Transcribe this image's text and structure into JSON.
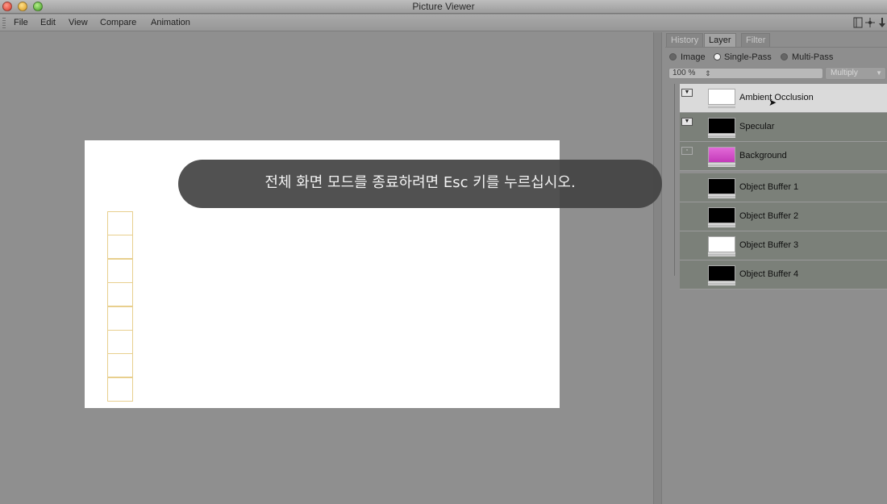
{
  "window": {
    "title": "Picture Viewer"
  },
  "menubar": {
    "items": [
      "File",
      "Edit",
      "View",
      "Compare",
      "Animation"
    ],
    "icons": [
      "panel-layout-icon",
      "move-icon",
      "pin-icon"
    ]
  },
  "canvas": {
    "background": "#ffffff",
    "cell_count": 8,
    "cell_border": "#e8cf8e"
  },
  "panel": {
    "tabs": [
      {
        "label": "History",
        "active": false
      },
      {
        "label": "Layer",
        "active": true
      },
      {
        "label": "Filter",
        "active": false
      }
    ],
    "modes": [
      {
        "label": "Image",
        "selected": false
      },
      {
        "label": "Single-Pass",
        "selected": true
      },
      {
        "label": "Multi-Pass",
        "selected": false
      }
    ],
    "opacity": "100 %",
    "blend_mode": "Multiply",
    "layers": [
      {
        "name": "Ambient Occlusion",
        "toggle": "visible",
        "thumb": "#ffffff",
        "active": true
      },
      {
        "name": "Specular",
        "toggle": "visible",
        "thumb": "#000000",
        "active": false
      },
      {
        "name": "Background",
        "toggle": "hollow",
        "thumb": "#d64ecb",
        "active": false
      },
      {
        "name": "Object Buffer 1",
        "toggle": "none",
        "thumb": "#000000",
        "active": false
      },
      {
        "name": "Object Buffer 2",
        "toggle": "none",
        "thumb": "#000000",
        "active": false
      },
      {
        "name": "Object Buffer 3",
        "toggle": "none",
        "thumb": "#ffffff",
        "active": false
      },
      {
        "name": "Object Buffer 4",
        "toggle": "none",
        "thumb": "#000000",
        "active": false
      }
    ]
  },
  "toast": {
    "message": "전체 화면 모드를 종료하려면 Esc 키를 누르십시오."
  }
}
